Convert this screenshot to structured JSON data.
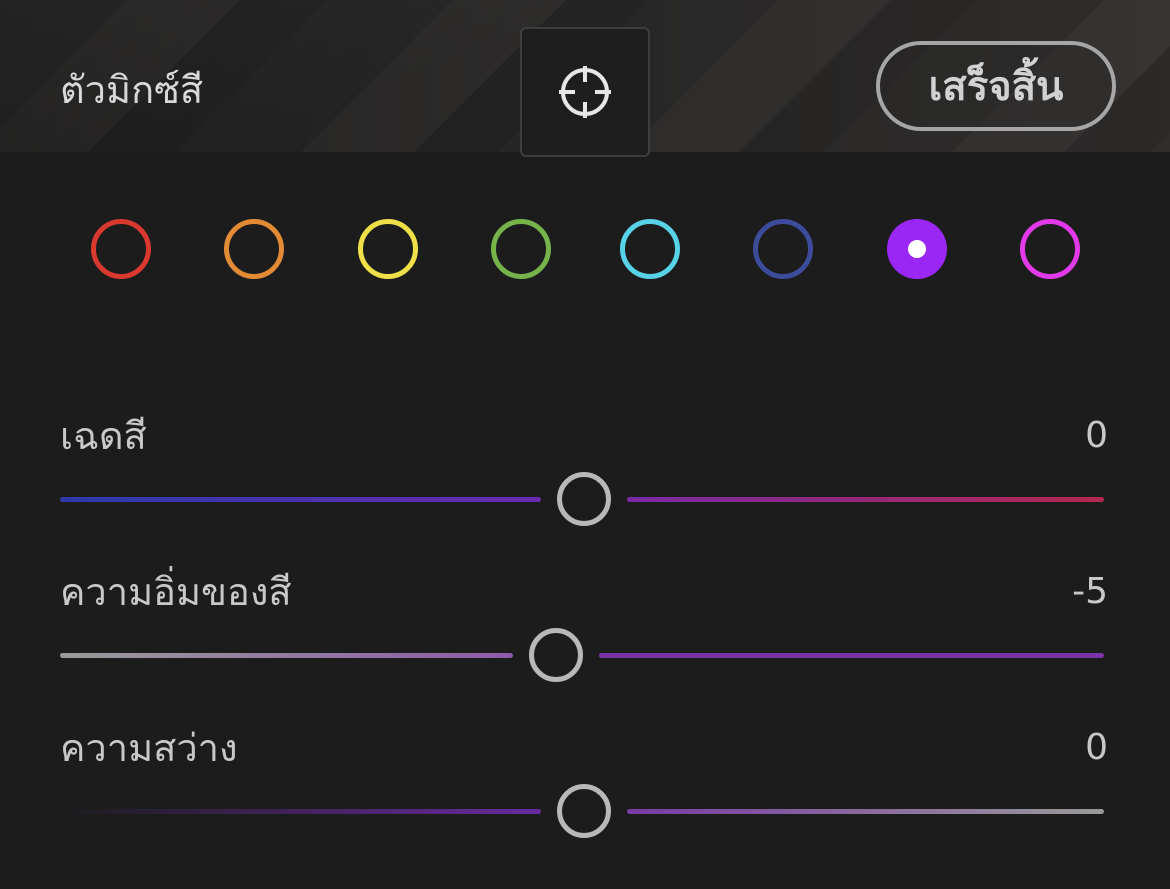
{
  "header": {
    "title": "ตัวมิกซ์สี",
    "done_label": "เสร็จสิ้น",
    "target_icon": "crosshair-target-icon"
  },
  "swatches": [
    {
      "name": "red",
      "color": "#d9392e",
      "selected": false
    },
    {
      "name": "orange",
      "color": "#e38a35",
      "selected": false
    },
    {
      "name": "yellow",
      "color": "#efe04a",
      "selected": false
    },
    {
      "name": "green",
      "color": "#76b34a",
      "selected": false
    },
    {
      "name": "aqua",
      "color": "#57d2e6",
      "selected": false
    },
    {
      "name": "blue",
      "color": "#3c4b9a",
      "selected": false
    },
    {
      "name": "purple",
      "color": "#9b27f5",
      "selected": true
    },
    {
      "name": "magenta",
      "color": "#e23ae8",
      "selected": false
    }
  ],
  "sliders": [
    {
      "label": "เฉดสี",
      "value": "0",
      "level": 0.5,
      "left_gradient": [
        "#2b3aa8",
        "#6a2bb0"
      ],
      "right_gradient": [
        "#7a2aa6",
        "#b3284f"
      ]
    },
    {
      "label": "ความอิ่มของสี",
      "value": "-5",
      "level": 0.475,
      "left_gradient": [
        "#9a9a9a",
        "#8d5aa8"
      ],
      "right_gradient": [
        "#7b34a8",
        "#7b34a8"
      ]
    },
    {
      "label": "ความสว่าง",
      "value": "0",
      "level": 0.5,
      "left_gradient": [
        "#1c1c1d",
        "#6a2aa0"
      ],
      "right_gradient": [
        "#7a3aa4",
        "#9a9a9a"
      ]
    }
  ]
}
